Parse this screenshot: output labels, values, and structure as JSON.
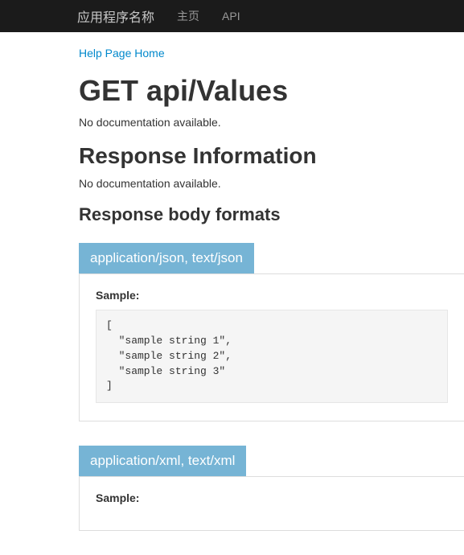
{
  "navbar": {
    "brand": "应用程序名称",
    "links": [
      {
        "label": "主页"
      },
      {
        "label": "API"
      }
    ]
  },
  "breadcrumb": {
    "home_label": "Help Page Home"
  },
  "page": {
    "title": "GET api/Values",
    "description": "No documentation available.",
    "response_info_heading": "Response Information",
    "response_info_desc": "No documentation available.",
    "body_formats_heading": "Response body formats"
  },
  "formats": [
    {
      "header": "application/json, text/json",
      "sample_label": "Sample:",
      "code": "[\n  \"sample string 1\",\n  \"sample string 2\",\n  \"sample string 3\"\n]"
    },
    {
      "header": "application/xml, text/xml",
      "sample_label": "Sample:",
      "code": ""
    }
  ]
}
